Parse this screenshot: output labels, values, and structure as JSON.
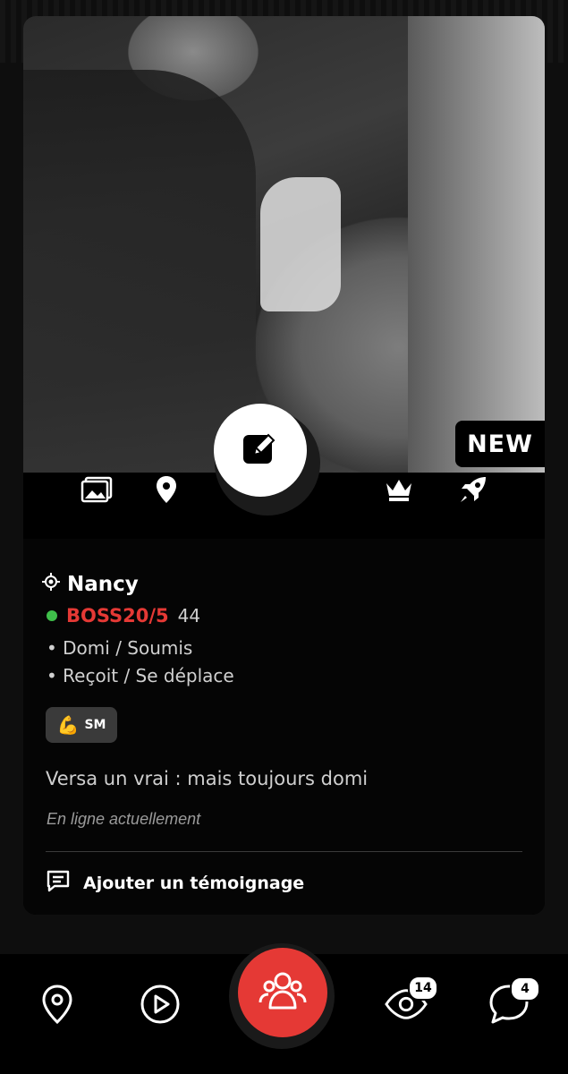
{
  "profile": {
    "badge": "NEW",
    "location": "Nancy",
    "username": "BOSS20/5",
    "age": "44",
    "online": true,
    "traits": [
      "• Domi / Soumis",
      "• Reçoit / Se déplace"
    ],
    "tag": {
      "emoji": "💪",
      "label": "SM"
    },
    "description": "Versa un vrai : mais toujours domi",
    "status": "En ligne actuellement",
    "testimony_label": "Ajouter un témoignage"
  },
  "action_bar": {
    "icons": [
      "photos-icon",
      "location-pin-icon",
      "edit-icon",
      "crown-icon",
      "rocket-icon"
    ]
  },
  "bottom_nav": {
    "items": [
      "map-pin-icon",
      "play-icon",
      "community-icon",
      "eye-icon",
      "chat-icon"
    ],
    "views_count": "14",
    "messages_count": "4"
  },
  "colors": {
    "accent": "#e53935",
    "online": "#3fbf4a"
  }
}
